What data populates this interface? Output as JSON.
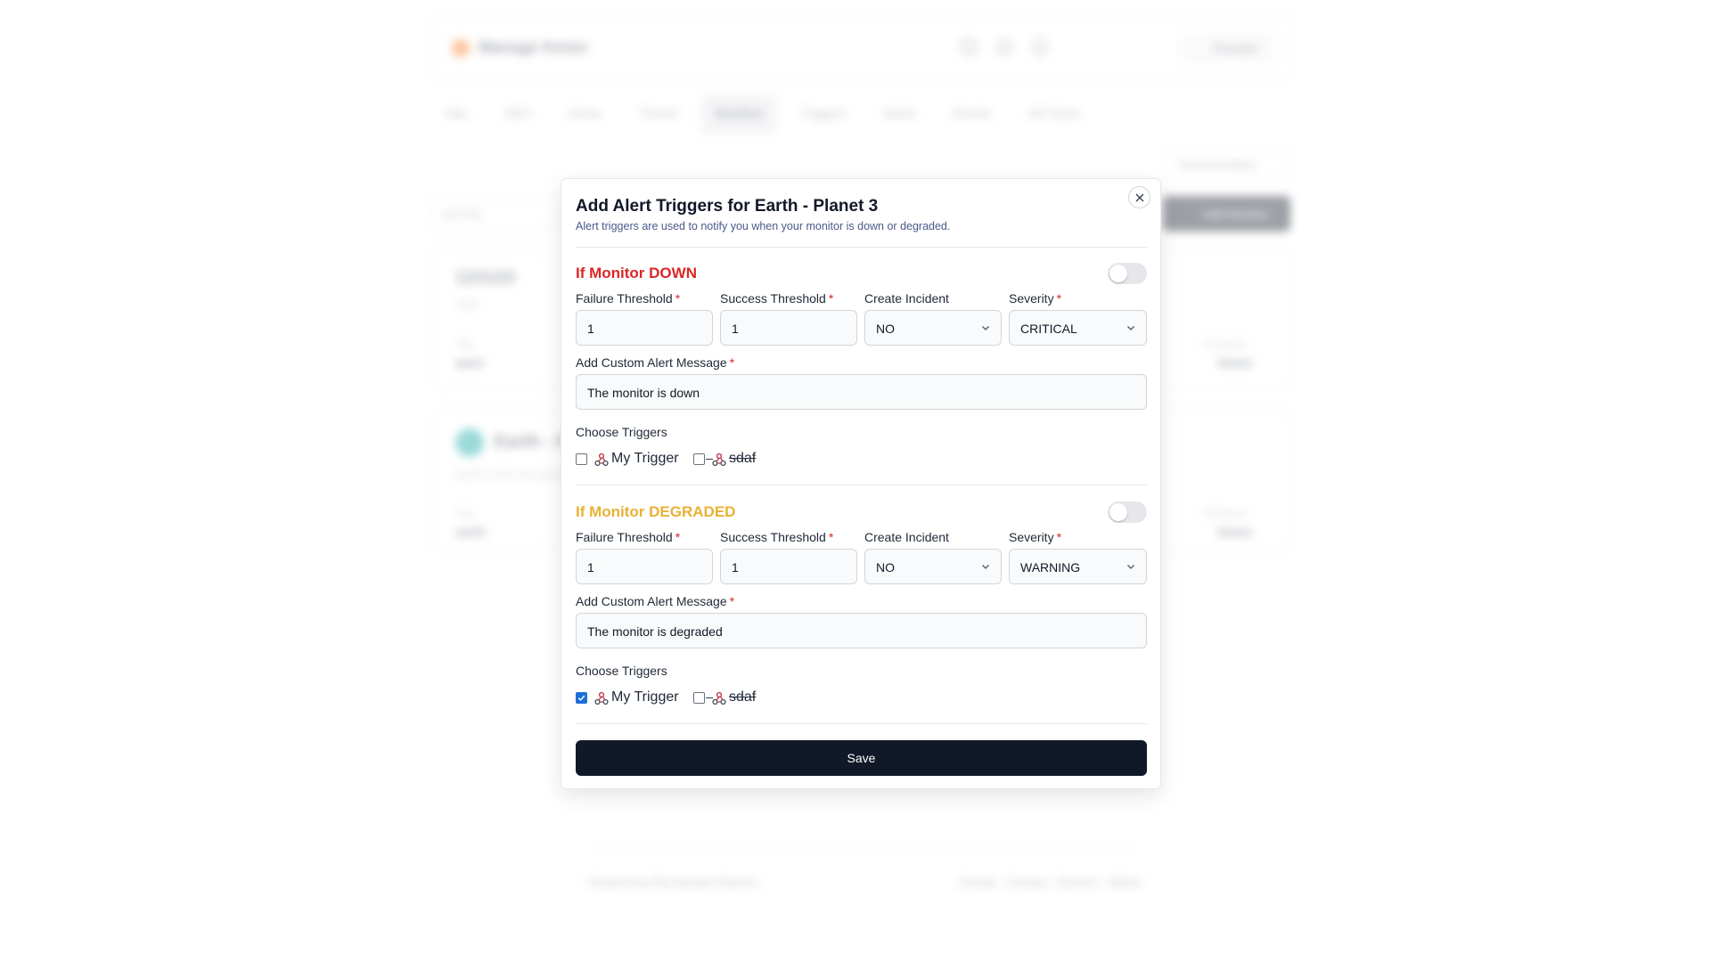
{
  "background": {
    "app_name": "Manage Kener",
    "preview_label": "Preview",
    "tabs": [
      "Site",
      "SEO",
      "Home",
      "Theme",
      "Monitors",
      "Triggers",
      "Alerts",
      "Events",
      "API Keys"
    ],
    "documentation_label": "Documentation",
    "status_filter": "ACTIVE",
    "add_monitor_label": "Add Monitor",
    "cards": [
      {
        "title": "123123",
        "subtitle": "asss",
        "tag_label": "Tag",
        "tag_value": "qwer",
        "category_label": "Category",
        "category_value": "Home"
      },
      {
        "title": "Earth - Pl",
        "subtitle": "Earth is the 3rd planet",
        "tag_label": "Tag",
        "tag_value": "earth",
        "category_label": "Category",
        "category_value": "Home"
      }
    ],
    "footer_left": "Powered by Raj Nandan Sharma",
    "footer_right": "Donate · Contact · Discord · Github"
  },
  "modal": {
    "title": "Add Alert Triggers for Earth - Planet 3",
    "subtitle": "Alert triggers are used to notify you when your monitor is down or degraded.",
    "save_label": "Save",
    "sections": [
      {
        "title": "If Monitor DOWN",
        "enabled": false,
        "failure_threshold_label": "Failure Threshold",
        "failure_threshold": "1",
        "success_threshold_label": "Success Threshold",
        "success_threshold": "1",
        "create_incident_label": "Create Incident",
        "create_incident": "NO",
        "severity_label": "Severity",
        "severity": "CRITICAL",
        "message_label": "Add Custom Alert Message",
        "message": "The monitor is down",
        "choose_triggers_label": "Choose Triggers",
        "triggers": [
          {
            "name": "My Trigger",
            "checked": false,
            "struck": false
          },
          {
            "name": "sdaf",
            "checked": false,
            "struck": true
          }
        ]
      },
      {
        "title": "If Monitor DEGRADED",
        "enabled": false,
        "failure_threshold_label": "Failure Threshold",
        "failure_threshold": "1",
        "success_threshold_label": "Success Threshold",
        "success_threshold": "1",
        "create_incident_label": "Create Incident",
        "create_incident": "NO",
        "severity_label": "Severity",
        "severity": "WARNING",
        "message_label": "Add Custom Alert Message",
        "message": "The monitor is degraded",
        "choose_triggers_label": "Choose Triggers",
        "triggers": [
          {
            "name": "My Trigger",
            "checked": true,
            "struck": false
          },
          {
            "name": "sdaf",
            "checked": false,
            "struck": true
          }
        ]
      }
    ]
  },
  "colors": {
    "down_title": "#dc2626",
    "degraded_title": "#e9b134",
    "checkbox_checked": "#1d6fd8",
    "save_button": "#111827"
  }
}
